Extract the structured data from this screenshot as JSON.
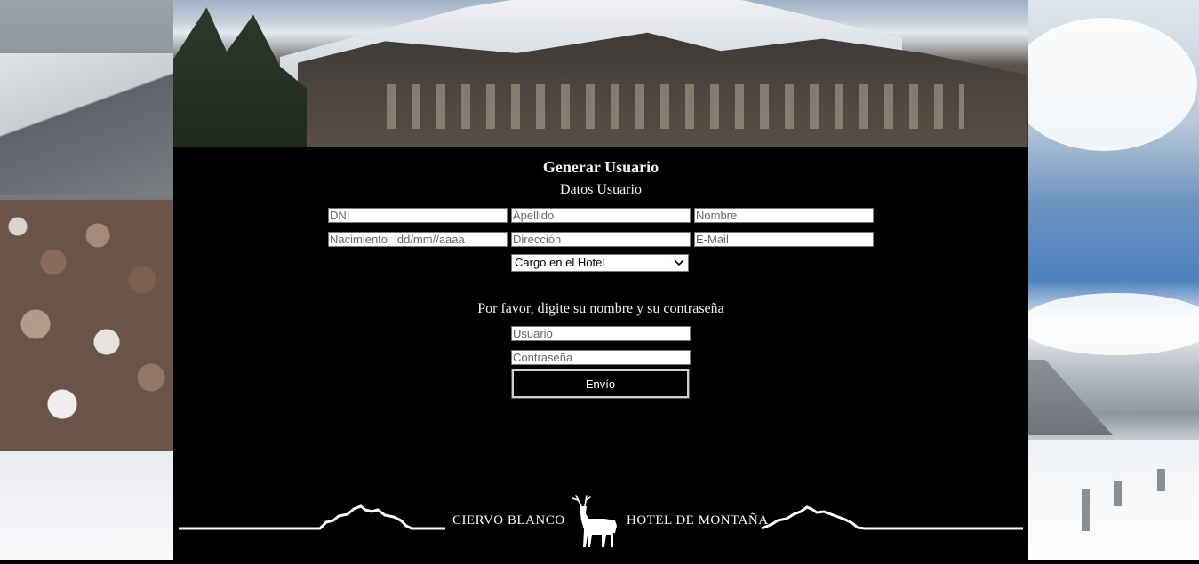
{
  "form": {
    "title": "Generar Usuario",
    "section_title": "Datos Usuario",
    "fields": {
      "dni_placeholder": "DNI",
      "apellido_placeholder": "Apellido",
      "nombre_placeholder": "Nombre",
      "nacimiento_placeholder": "Nacimiento   dd/mm//aaaa",
      "direccion_placeholder": "Dirección",
      "email_placeholder": "E-Mail"
    },
    "cargo_select": "Cargo en el Hotel",
    "login_prompt": "Por favor, digite su nombre y su contraseña",
    "usuario_placeholder": "Usuario",
    "password_placeholder": "Contraseña",
    "submit_label": "Envío"
  },
  "footer": {
    "brand_left": "CIERVO   BLANCO",
    "brand_right": "HOTEL DE MONTAÑA"
  },
  "icons": {
    "deer": "deer-logo-icon",
    "mountains": "mountain-silhouette-icon",
    "chevron": "chevron-down-icon"
  }
}
